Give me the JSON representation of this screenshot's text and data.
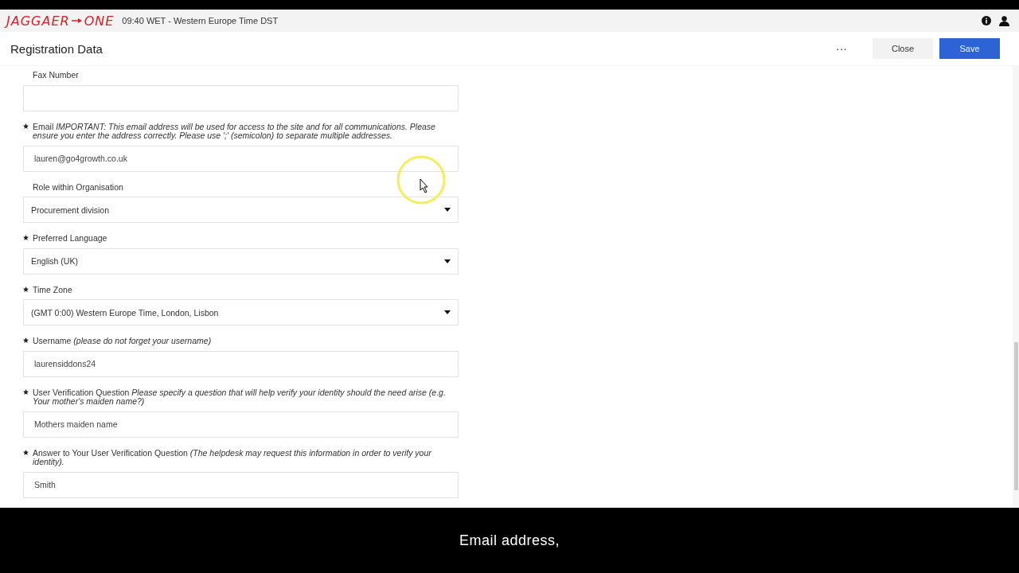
{
  "header": {
    "logo": "JAGGAER",
    "logo_suffix": "ONE",
    "time": "09:40 WET - Western Europe Time DST"
  },
  "title_bar": {
    "title": "Registration Data",
    "more": "···",
    "buttons": [
      {
        "label": "Close",
        "kind": "secondary"
      },
      {
        "label": "Save",
        "kind": "primary"
      }
    ]
  },
  "fields": [
    {
      "kind": "text",
      "required": false,
      "label": "Fax Number"
    },
    {
      "kind": "text",
      "required": true,
      "label": "Email *IMPORTANT: This email address will be used for access to the site and for all communications. Please ensure you enter the address correctly. Please use ';' (semicolon) to separate multiple addresses.*",
      "value": "lauren@go4growth.co.uk"
    },
    {
      "kind": "select",
      "required": false,
      "label": "Role within Organisation",
      "value": "Procurement division"
    },
    {
      "kind": "select",
      "required": true,
      "label": "Preferred Language",
      "value": "English (UK)"
    },
    {
      "kind": "select",
      "required": true,
      "label": "Time Zone",
      "value": "(GMT 0:00) Western Europe Time, London, Lisbon"
    },
    {
      "kind": "text",
      "required": true,
      "label": "Username *(please do not forget your username)*",
      "value": "laurensiddons24"
    },
    {
      "kind": "text",
      "required": true,
      "label": "User Verification Question *Please specify a question that will help verify your identity should the need arise (e.g. Your mother's maiden name?)*",
      "value": "Mothers maiden name"
    },
    {
      "kind": "text",
      "required": true,
      "label": "Answer to Your User Verification Question *(The helpdesk may request this information in order to verify your identity).*",
      "value": "Smith"
    }
  ],
  "caption": "Email address,"
}
